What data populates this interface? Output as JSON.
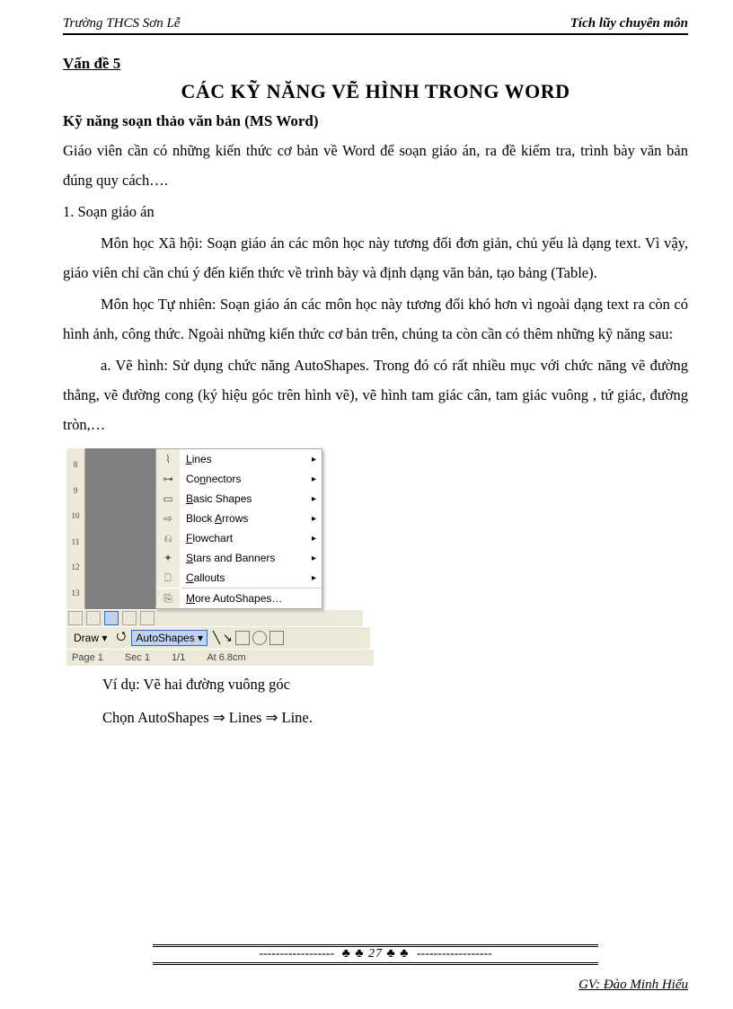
{
  "header": {
    "left": "Trường   THCS Sơn Lễ",
    "right": "Tích lũy chuyên môn"
  },
  "topic": "Vấn đề 5",
  "title": "CÁC KỸ NĂNG VẼ HÌNH TRONG WORD",
  "subtitle": "Kỹ năng soạn thảo văn bản (MS Word)",
  "p1": "Giáo viên cần có những kiến thức cơ bản về Word để soạn giáo án, ra đề kiểm tra, trình bày văn bản đúng quy cách….",
  "p2": "1. Soạn giáo án",
  "p3": "Môn học Xã hội: Soạn giáo án các môn học này tương đối đơn giản, chủ yếu là dạng text. Vì vậy, giáo viên chỉ cần chú ý đến kiến thức về trình bày và định dạng văn bản, tạo bảng (Table).",
  "p4": "Môn học Tự nhiên:  Soạn giáo án các môn học này tương đối khó hơn vì ngoài dạng text ra còn có hình ảnh, công thức. Ngoài những kiến thức cơ bản trên, chúng ta còn cần có thêm những kỹ năng sau:",
  "p5": "a. Vẽ hình: Sử dụng chức năng AutoShapes. Trong đó có rất nhiều mục với chức năng vẽ đường thẳng, vẽ đường cong (ký hiệu góc trên hình vẽ), vẽ hình tam giác cân, tam giác vuông , tứ giác, đường tròn,…",
  "ruler_ticks": [
    "13",
    "12",
    "11",
    "10",
    "9",
    "8"
  ],
  "menu": {
    "items": [
      {
        "icon": "⌇",
        "label": "Lines",
        "u": "L",
        "arrow": true
      },
      {
        "icon": "⊶",
        "label": "Connectors",
        "u": "N",
        "arrow": true
      },
      {
        "icon": "▭",
        "label": "Basic Shapes",
        "u": "B",
        "arrow": true
      },
      {
        "icon": "⇨",
        "label": "Block Arrows",
        "u": "A",
        "arrow": true
      },
      {
        "icon": "⎌",
        "label": "Flowchart",
        "u": "F",
        "arrow": true
      },
      {
        "icon": "✦",
        "label": "Stars and Banners",
        "u": "S",
        "arrow": true
      },
      {
        "icon": "⎕",
        "label": "Callouts",
        "u": "C",
        "arrow": true
      }
    ],
    "more": {
      "icon": "⎘",
      "label": "More AutoShapes…",
      "u": "M"
    }
  },
  "drawbar": {
    "draw": "Draw ▾",
    "auto": "AutoShapes ▾"
  },
  "statusbar": {
    "page": "Page 1",
    "sec": "Sec 1",
    "pages": "1/1",
    "at": "At 6.8cm"
  },
  "example1": "Ví dụ: Vẽ hai đường vuông góc",
  "example2": "Chọn AutoShapes ⇒ Lines ⇒ Line.",
  "footer": {
    "page": "27",
    "clubs": "♣ ♣",
    "author": "GV: Đào Minh Hiếu"
  }
}
